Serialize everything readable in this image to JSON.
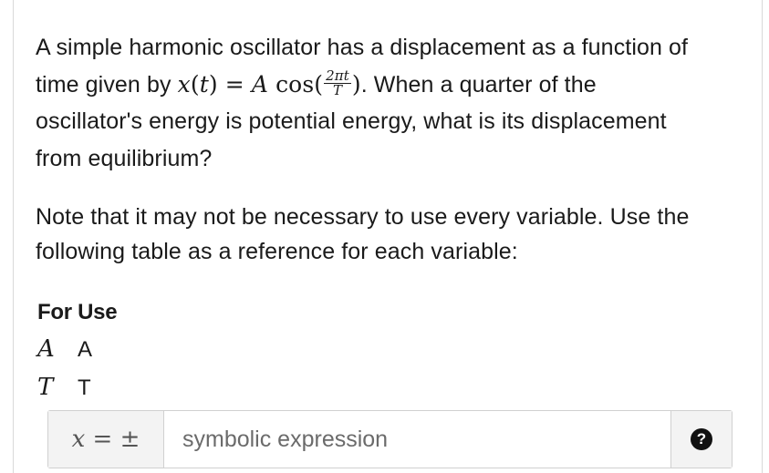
{
  "question": {
    "line1": "A simple harmonic oscillator has a displacement as a function of",
    "line2_pre": "time given by",
    "formula": {
      "lhs_var": "x",
      "lhs_arg": "t",
      "equals": "=",
      "amp": "A",
      "func": "cos",
      "frac_num": "2πt",
      "frac_den": "T"
    },
    "line2_post": ". When a quarter of the",
    "line3": "oscillator's energy is potential energy, what is its displacement",
    "line4": "from equilibrium?"
  },
  "note": {
    "line1": "Note that it may not be necessary to use every variable. Use the",
    "line2": "following table as a reference for each variable:"
  },
  "variable_table": {
    "header": "For Use",
    "rows": [
      {
        "symbol": "A",
        "use": "A"
      },
      {
        "symbol": "T",
        "use": "T"
      }
    ]
  },
  "answer": {
    "prefix_var": "x",
    "prefix_rest": " = ±",
    "placeholder": "symbolic expression",
    "value": "",
    "help_label": "?"
  }
}
